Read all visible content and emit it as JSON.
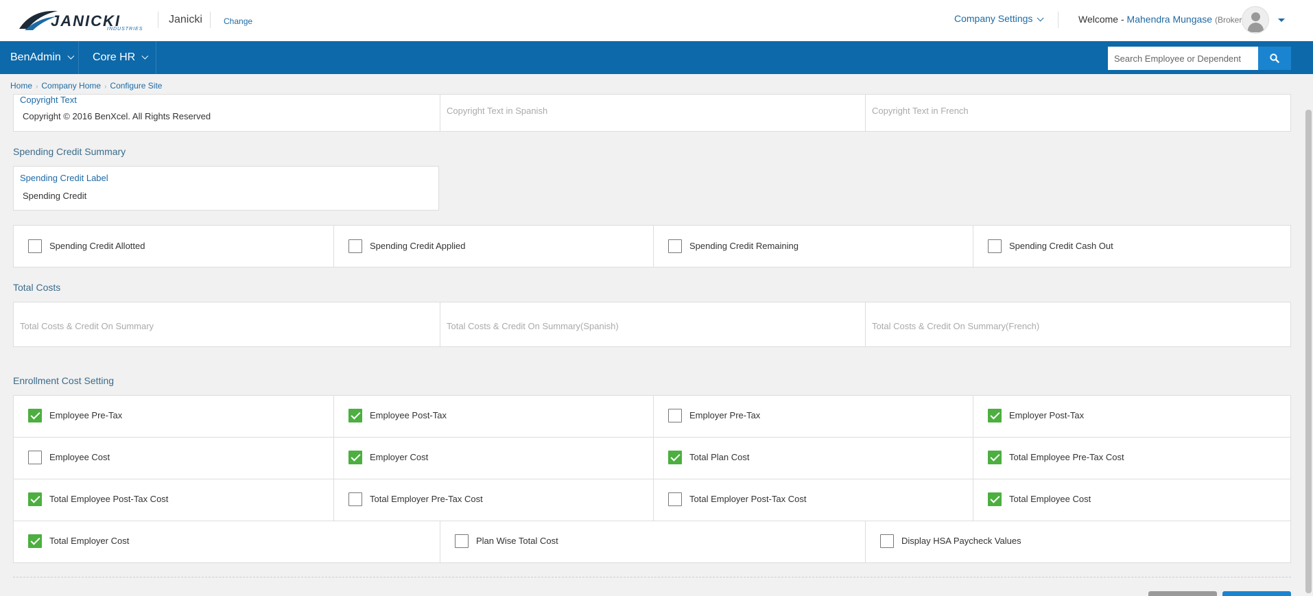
{
  "header": {
    "logo_text": "JANICKI",
    "logo_subtext": "INDUSTRIES",
    "company_name": "Janicki",
    "change_label": "Change",
    "company_settings_label": "Company Settings",
    "welcome_prefix": "Welcome -",
    "user_name": "Mahendra Mungase",
    "user_role": "(Broker)"
  },
  "nav": {
    "items": [
      {
        "label": "BenAdmin"
      },
      {
        "label": "Core HR"
      }
    ],
    "search_placeholder": "Search Employee or Dependent"
  },
  "breadcrumb": [
    "Home",
    "Company Home",
    "Configure Site"
  ],
  "copyright": {
    "label": "Copyright Text",
    "value": "Copyright © 2016 BenXcel. All Rights Reserved",
    "spanish_placeholder": "Copyright Text in Spanish",
    "french_placeholder": "Copyright Text in French"
  },
  "spending_credit_summary": {
    "title": "Spending Credit Summary",
    "label": "Spending Credit Label",
    "value": "Spending Credit",
    "options": [
      {
        "label": "Spending Credit Allotted",
        "checked": false
      },
      {
        "label": "Spending Credit Applied",
        "checked": false
      },
      {
        "label": "Spending Credit Remaining",
        "checked": false
      },
      {
        "label": "Spending Credit Cash Out",
        "checked": false
      }
    ]
  },
  "total_costs": {
    "title": "Total Costs",
    "placeholders": [
      "Total Costs & Credit On Summary",
      "Total Costs & Credit On Summary(Spanish)",
      "Total Costs & Credit On Summary(French)"
    ]
  },
  "enrollment_cost_setting": {
    "title": "Enrollment Cost Setting",
    "rows": [
      [
        {
          "label": "Employee Pre-Tax",
          "checked": true
        },
        {
          "label": "Employee Post-Tax",
          "checked": true
        },
        {
          "label": "Employer Pre-Tax",
          "checked": false
        },
        {
          "label": "Employer Post-Tax",
          "checked": true
        }
      ],
      [
        {
          "label": "Employee Cost",
          "checked": false
        },
        {
          "label": "Employer Cost",
          "checked": true
        },
        {
          "label": "Total Plan Cost",
          "checked": true
        },
        {
          "label": "Total Employee Pre-Tax Cost",
          "checked": true
        }
      ],
      [
        {
          "label": "Total Employee Post-Tax Cost",
          "checked": true
        },
        {
          "label": "Total Employer Pre-Tax Cost",
          "checked": false
        },
        {
          "label": "Total Employer Post-Tax Cost",
          "checked": false
        },
        {
          "label": "Total Employee Cost",
          "checked": true
        }
      ],
      [
        {
          "label": "Total Employer Cost",
          "checked": true
        },
        {
          "label": "Plan Wise Total Cost",
          "checked": false
        },
        {
          "label": "Display HSA Paycheck Values",
          "checked": false
        }
      ]
    ]
  },
  "colors": {
    "primary": "#0d69a9",
    "link": "#1d6aa5",
    "checked": "#4caf3f"
  }
}
